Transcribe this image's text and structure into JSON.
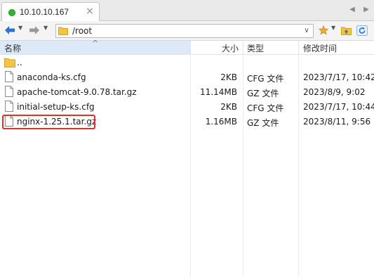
{
  "tab": {
    "title": "10.10.10.167",
    "close": "×"
  },
  "toolbar": {
    "path": "/root"
  },
  "columns": {
    "name": "名称",
    "size": "大小",
    "type": "类型",
    "modified": "修改时间"
  },
  "files": [
    {
      "name": "..",
      "size": "",
      "type": "",
      "modified": "",
      "icon": "folder-icon"
    },
    {
      "name": "anaconda-ks.cfg",
      "size": "2KB",
      "type": "CFG 文件",
      "modified": "2023/7/17, 10:42",
      "icon": "file-icon"
    },
    {
      "name": "apache-tomcat-9.0.78.tar.gz",
      "size": "11.14MB",
      "type": "GZ 文件",
      "modified": "2023/8/9, 9:02",
      "icon": "file-icon"
    },
    {
      "name": "initial-setup-ks.cfg",
      "size": "2KB",
      "type": "CFG 文件",
      "modified": "2023/7/17, 10:44",
      "icon": "file-icon"
    },
    {
      "name": "nginx-1.25.1.tar.gz",
      "size": "1.16MB",
      "type": "GZ 文件",
      "modified": "2023/8/11, 9:56",
      "icon": "file-icon",
      "highlighted": true
    }
  ],
  "colors": {
    "connected": "#2eb82e",
    "highlight": "#d9342b",
    "selected_column": "#dde9f6",
    "folder": "#f5c542"
  }
}
